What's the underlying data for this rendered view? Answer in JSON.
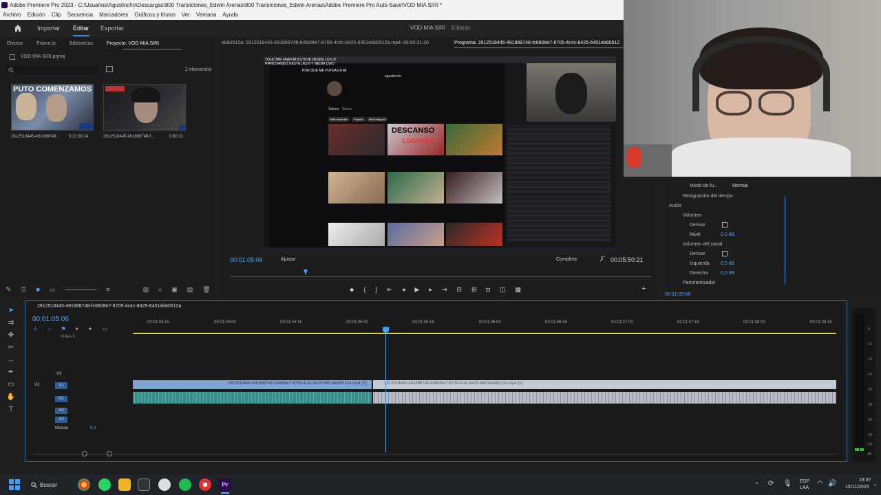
{
  "window": {
    "title": "Adobe Premiere Pro 2023 - C:\\Usuarios\\Agustincho\\Descargas\\800 Transiciones_Edwin Arenas\\800 Transiciones_Edwin Arenas\\Adobe Premiere Pro Auto-Save\\VOD MIA SIRI *"
  },
  "menu": [
    "Archivo",
    "Edición",
    "Clip",
    "Secuencia",
    "Marcadores",
    "Gráficos y títulos",
    "Ver",
    "Ventana",
    "Ayuda"
  ],
  "appbar": {
    "modes": [
      "Importar",
      "Editar",
      "Exportar"
    ],
    "active_mode": "Editar",
    "project_title": "VOD MIA SIRI",
    "project_status": "Editado"
  },
  "project_panel": {
    "tabs": [
      "Efectos",
      "Frame.io",
      "Bibliotecas",
      "Proyecto: VOD MIA SIRI"
    ],
    "active_tab": "Proyecto: VOD MIA SIRI",
    "file_name": "VOD MIA SIRI.prproj",
    "count": "2 elementos",
    "items": [
      {
        "name": "2612518445-491898748...",
        "duration": "5:21:39:14",
        "overlay": "PUTO COMENZAMOS"
      },
      {
        "name": "2612518445-491898748-f...",
        "duration": "5:50:21"
      }
    ]
  },
  "source_monitor": {
    "tab": "eb80512a: 2612518445-491898748-fc6608e7-8705-4c4c-8425-6451eb80512a.mp4: 00:00:31:20",
    "program_tab": "Programa: 2612518445-491898748-fc6608e7-8705-4c4c-8425-6451eb80512",
    "timecode": "00:01:05:06",
    "fit": "Ajustar",
    "quality": "Completa",
    "duration": "00:05:50:21"
  },
  "video": {
    "overlay_top": "TOLICTAN XFAVOR ESTUVE DESDE LOS 37 PIANCHANDO HASTA LAS 8 Y MEDIA CWO",
    "overlay_mid": "POR QUE ME PUTEAS A MI",
    "headline": "DESCANSO",
    "subheadline": "LOGRADA",
    "search_text": "agustincho",
    "tabs": [
      "Videos",
      "Shorts"
    ],
    "filters": [
      "Más recientes",
      "Popular",
      "Más antiguos"
    ]
  },
  "effects_panel": {
    "rows": [
      {
        "label": "Modo de fu...",
        "value": "Normal"
      },
      {
        "label": "Resignación del tiempo"
      },
      {
        "label": "Audio"
      },
      {
        "label": "Volumen"
      },
      {
        "label": "Derivar"
      },
      {
        "label": "Nivel",
        "value": "0,0 dB"
      },
      {
        "label": "Volumen del canal"
      },
      {
        "label": "Derivar"
      },
      {
        "label": "Izquierda",
        "value": "0,0 dB"
      },
      {
        "label": "Derecha",
        "value": "0,0 dB"
      },
      {
        "label": "Panoramizador"
      }
    ],
    "timecode": "00:01:05:06"
  },
  "timeline": {
    "sequence_tab": "2612518445-491898748-fc6608e7-8705-4c4c-8425-6451eb80512a",
    "timecode": "00:01:05:06",
    "ruler": [
      "00:01:03:15",
      "00:01:04:00",
      "00:01:04:15",
      "00:01:05:00",
      "00:01:05:15",
      "00:01:06:00",
      "00:01:06:15",
      "00:01:07:00",
      "00:01:07:15",
      "00:01:08:00",
      "00:01:08:15"
    ],
    "tracks": {
      "video": [
        "V3",
        "V2",
        "V1"
      ],
      "audio": [
        "A1",
        "A2",
        "A3"
      ],
      "video3_name": "Vídeo 3",
      "mix_label": "Mezcla",
      "mix_value": "0,0"
    },
    "clip_name_a": "2612518445-491898748-fc6608e7-8705-4c4c-8425-6451eb80512a.mp4 [V]",
    "clip_name_b": "2612518445-491898748-fc6608e7-8705-4c4c-8425-6451eb80512a.mp4 [V]",
    "meter_labels": [
      "-6",
      "-12",
      "-18",
      "-24",
      "-30",
      "-36",
      "-42",
      "-48",
      "-54",
      "dB"
    ]
  },
  "taskbar": {
    "search": "Buscar",
    "lang_top": "ESP",
    "lang_bottom": "LAA",
    "time": "23:37",
    "date": "15/11/2025"
  },
  "colors": {
    "accent": "#2d8ceb",
    "video_clip": "#7ea4d6",
    "audio_clip": "#3a8d8a",
    "playhead": "#4aa3ff"
  }
}
